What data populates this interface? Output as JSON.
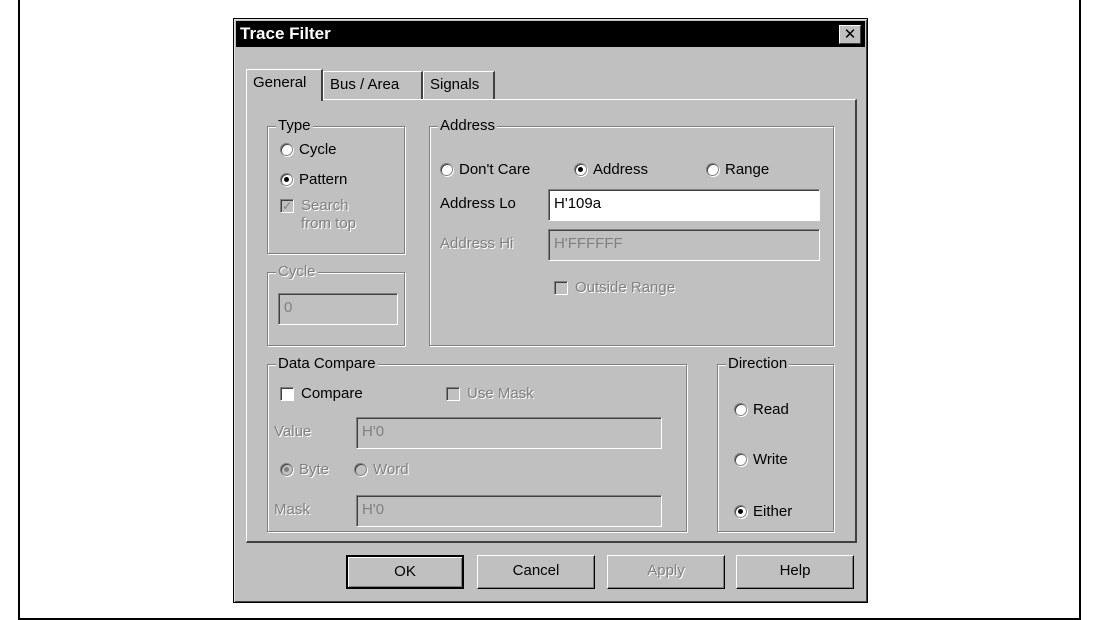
{
  "dialog": {
    "title": "Trace Filter",
    "close_glyph": "✕"
  },
  "tabs": [
    {
      "label": "General",
      "active": true
    },
    {
      "label": "Bus / Area",
      "active": false
    },
    {
      "label": "Signals",
      "active": false
    }
  ],
  "type_group": {
    "legend": "Type",
    "cycle_label": "Cycle",
    "pattern_label": "Pattern",
    "selected": "Pattern",
    "search_label_line1": "Search",
    "search_label_line2": "from top",
    "search_checked": true
  },
  "cycle_group": {
    "legend": "Cycle",
    "value": "0"
  },
  "address_group": {
    "legend": "Address",
    "dont_care_label": "Don't Care",
    "address_label": "Address",
    "range_label": "Range",
    "selected": "Address",
    "address_lo_label": "Address Lo",
    "address_lo_value": "H'109a",
    "address_hi_label": "Address Hi",
    "address_hi_value": "H'FFFFFF",
    "outside_range_label": "Outside Range",
    "outside_range_checked": false
  },
  "data_compare_group": {
    "legend": "Data Compare",
    "compare_label": "Compare",
    "compare_checked": false,
    "use_mask_label": "Use Mask",
    "use_mask_checked": false,
    "value_label": "Value",
    "value_value": "H'0",
    "byte_label": "Byte",
    "word_label": "Word",
    "selected_size": "Byte",
    "mask_label": "Mask",
    "mask_value": "H'0"
  },
  "direction_group": {
    "legend": "Direction",
    "read_label": "Read",
    "write_label": "Write",
    "either_label": "Either",
    "selected": "Either"
  },
  "buttons": {
    "ok": "OK",
    "cancel": "Cancel",
    "apply": "Apply",
    "help": "Help"
  }
}
